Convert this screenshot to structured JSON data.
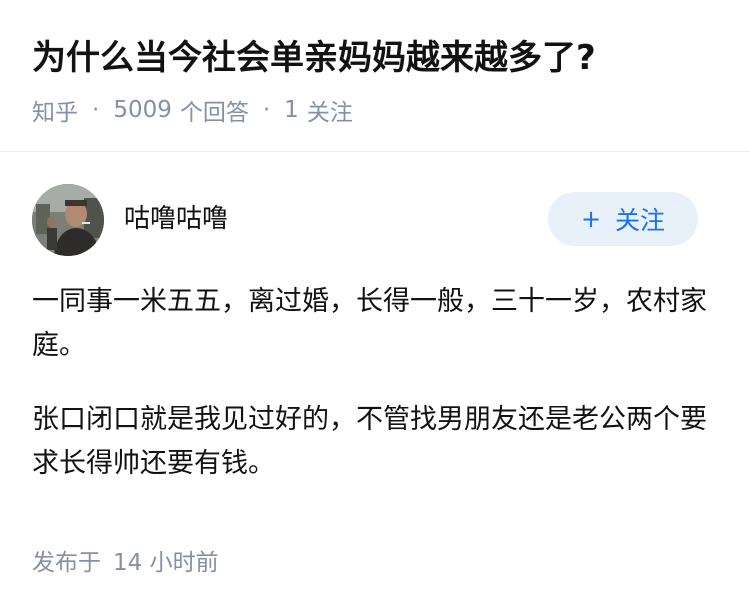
{
  "question": {
    "title": "为什么当今社会单亲妈妈越来越多了?",
    "source": "知乎",
    "separator": "·",
    "answer_count": "5009",
    "answer_label": "个回答",
    "follow_count": "1",
    "follow_label": "关注"
  },
  "author": {
    "name": "咕噜咕噜",
    "follow_button": {
      "icon": "+",
      "label": "关注"
    }
  },
  "answer": {
    "paragraphs": [
      "一同事一米五五，离过婚，长得一般，三十一岁，农村家庭。",
      "张口闭口就是我见过好的，不管找男朋友还是老公两个要求长得帅还要有钱。"
    ]
  },
  "footer": {
    "publish_label": "发布于",
    "publish_time": "14 小时前"
  },
  "colors": {
    "text_primary": "#121212",
    "text_secondary": "#8590a6",
    "accent_blue": "#1772f6",
    "button_bg": "#e8f0fa"
  },
  "icons": {
    "avatar": "avatar-photo",
    "follow": "plus-icon"
  }
}
